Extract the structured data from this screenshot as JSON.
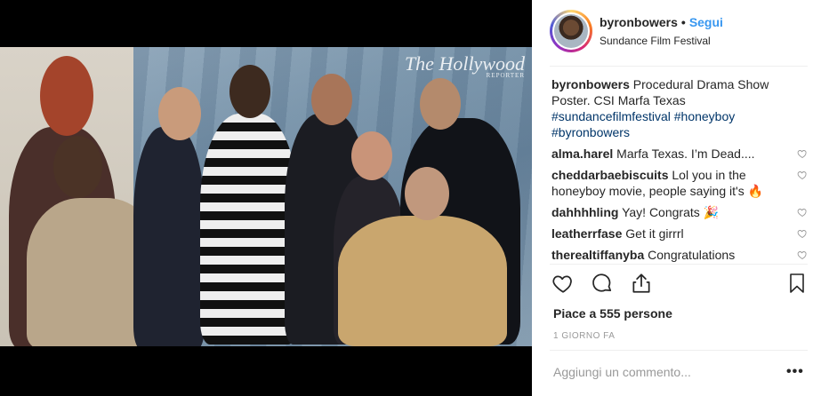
{
  "post": {
    "username": "byronbowers",
    "follow_label": "Segui",
    "location": "Sundance Film Festival",
    "watermark_title": "The Hollywood",
    "watermark_sub": "REPORTER"
  },
  "caption": {
    "username": "byronbowers",
    "text": "Procedural Drama Show Poster. CSI Marfa Texas",
    "hashtags": [
      "#sundancefilmfestival",
      "#honeyboy",
      "#byronbowers"
    ]
  },
  "comments": [
    {
      "username": "alma.harel",
      "text": "Marfa Texas. I’m Dead...."
    },
    {
      "username": "cheddarbaebiscuits",
      "text": "Lol you in the honeyboy movie, people saying it's 🔥"
    },
    {
      "username": "dahhhhling",
      "text": "Yay! Congrats 🎉"
    },
    {
      "username": "leatherrfase",
      "text": "Get it girrrl"
    },
    {
      "username": "therealtiffanyba",
      "text": "Congratulations"
    }
  ],
  "actions": {
    "like_icon": "heart-icon",
    "comment_icon": "comment-icon",
    "share_icon": "share-icon",
    "save_icon": "bookmark-icon"
  },
  "likes_text": "Piace a 555 persone",
  "time_text": "1 GIORNO FA",
  "add_comment_placeholder": "Aggiungi un commento...",
  "more_label": "•••",
  "colors": {
    "link": "#3897f0",
    "hashtag": "#003569",
    "muted": "#999999"
  }
}
